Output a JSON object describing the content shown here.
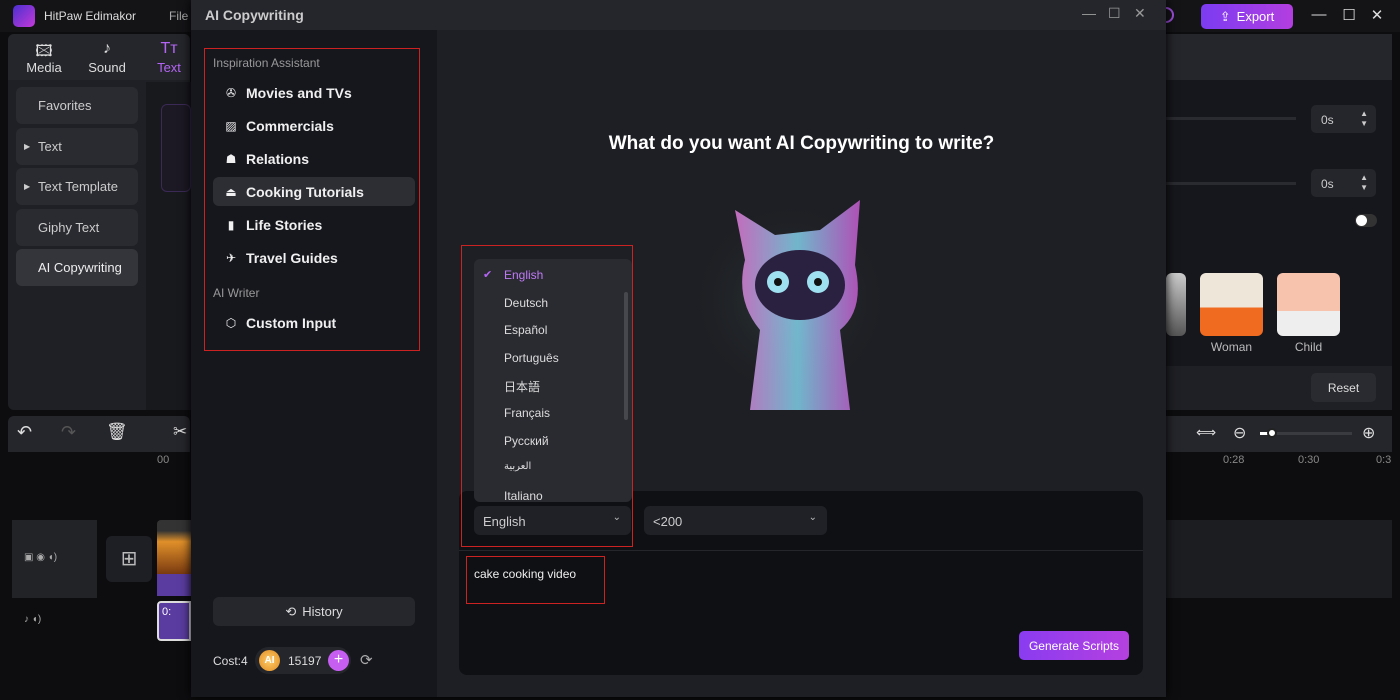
{
  "app": {
    "title": "HitPaw Edimakor",
    "menu_file": "File",
    "export_label": "Export",
    "accent": "#8b3cf0"
  },
  "tabs": [
    {
      "label": "Media",
      "icon": "media-icon"
    },
    {
      "label": "Sound",
      "icon": "music-note-icon"
    },
    {
      "label": "Text",
      "icon": "text-icon",
      "active": true
    }
  ],
  "categories": [
    {
      "label": "Favorites"
    },
    {
      "label": "Text",
      "expandable": true
    },
    {
      "label": "Text Template",
      "expandable": true
    },
    {
      "label": "Giphy Text"
    },
    {
      "label": "AI Copywriting",
      "selected": true
    }
  ],
  "right_panel": {
    "spin1": "0s",
    "spin2": "0s",
    "toggle_on": false,
    "avatars": [
      "Woman",
      "Child"
    ],
    "reset_label": "Reset",
    "ruler": [
      "0:28",
      "0:30",
      "0:3"
    ]
  },
  "timeline": {
    "ruler_start": "00",
    "clip_label": "0:"
  },
  "dialog": {
    "title": "AI Copywriting",
    "section1": "Inspiration Assistant",
    "items": [
      {
        "label": "Movies and TVs",
        "icon": "film-reel-icon"
      },
      {
        "label": "Commercials",
        "icon": "chart-icon"
      },
      {
        "label": "Relations",
        "icon": "people-icon"
      },
      {
        "label": "Cooking Tutorials",
        "icon": "cloche-icon",
        "selected": true
      },
      {
        "label": "Life Stories",
        "icon": "book-icon"
      },
      {
        "label": "Travel Guides",
        "icon": "airplane-icon"
      }
    ],
    "section2": "AI Writer",
    "custom_input": "Custom Input",
    "history_label": "History",
    "cost_label": "Cost:4",
    "coin_label": "AI",
    "credits": "15197",
    "question": "What do you want AI Copywriting to write?",
    "languages": [
      "English",
      "Deutsch",
      "Español",
      "Português",
      "日本語",
      "Français",
      "Русский",
      "العربية",
      "Italiano"
    ],
    "selected_language": "English",
    "length": "<200",
    "prompt": "cake cooking video",
    "generate_label": "Generate Scripts"
  }
}
